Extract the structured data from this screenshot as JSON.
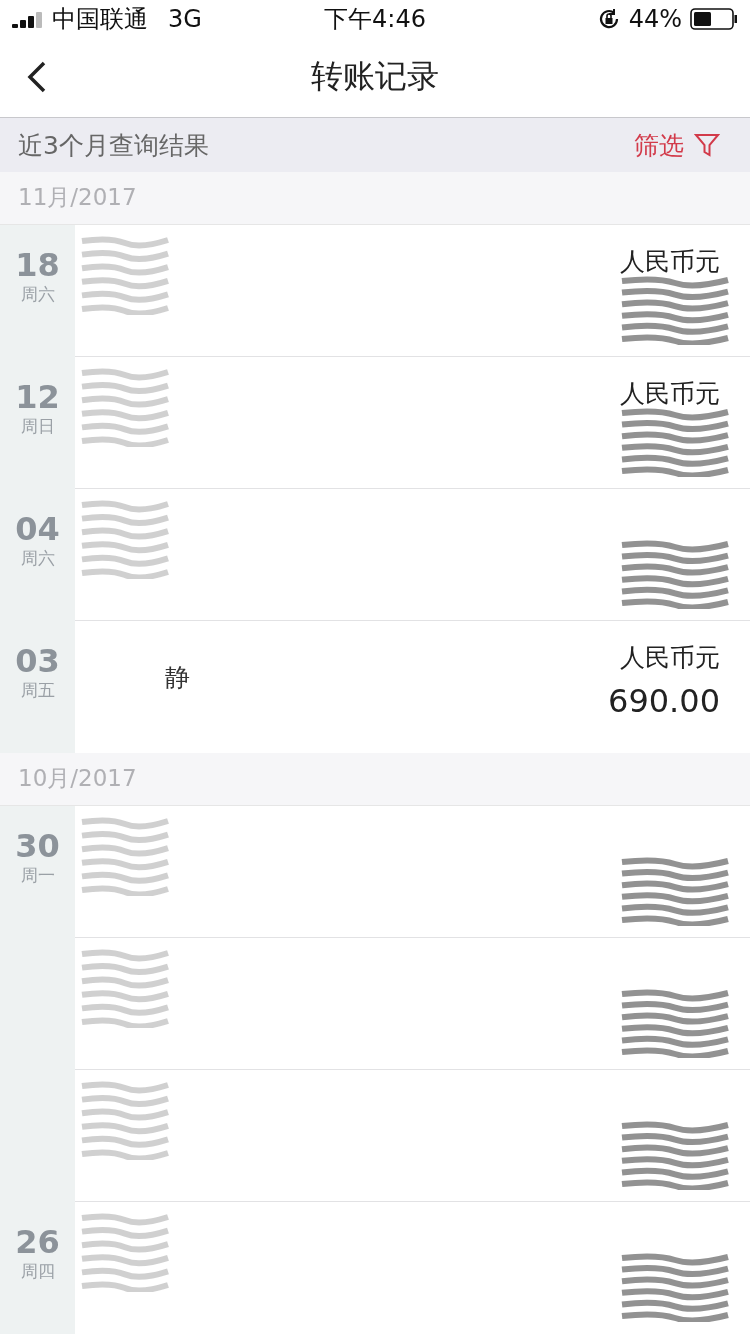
{
  "status_bar": {
    "carrier": "中国联通",
    "network": "3G",
    "time": "下午4:46",
    "battery": "44%"
  },
  "nav": {
    "title": "转账记录"
  },
  "filter_bar": {
    "summary": "近3个月查询结果",
    "filter_label": "筛选"
  },
  "groups": [
    {
      "month": "11月/2017",
      "rows": [
        {
          "day": "18",
          "weekday": "周六",
          "name": "",
          "currency": "人民币元",
          "amount": "",
          "redacted": true
        },
        {
          "day": "12",
          "weekday": "周日",
          "name": "",
          "currency": "人民币元",
          "amount": "",
          "redacted": true
        },
        {
          "day": "04",
          "weekday": "周六",
          "name": "",
          "currency": "",
          "amount": "",
          "redacted": true
        },
        {
          "day": "03",
          "weekday": "周五",
          "name": "静",
          "currency": "人民币元",
          "amount": "690.00",
          "redacted": false
        }
      ]
    },
    {
      "month": "10月/2017",
      "rows": [
        {
          "day": "30",
          "weekday": "周一",
          "name": "",
          "currency": "",
          "amount": "",
          "redacted": true
        },
        {
          "day": "",
          "weekday": "",
          "name": "",
          "currency": "",
          "amount": "",
          "redacted": true
        },
        {
          "day": "",
          "weekday": "",
          "name": "",
          "currency": "",
          "amount": "",
          "redacted": true
        },
        {
          "day": "26",
          "weekday": "周四",
          "name": "",
          "currency": "",
          "amount": "",
          "redacted": true
        }
      ]
    }
  ]
}
